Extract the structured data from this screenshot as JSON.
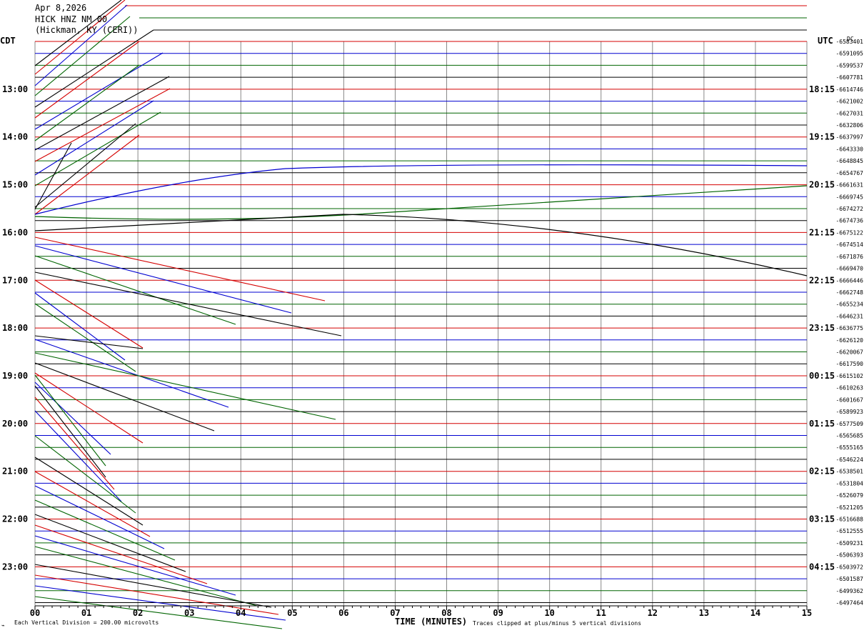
{
  "header": {
    "date": "Apr 8,2026",
    "station": "HICK HNZ NM 00",
    "location": "(Hickman, KY (CERI))"
  },
  "left_tz": "CDT",
  "right_tz": "UTC",
  "dc_header": "DC",
  "footer": {
    "scale": "Each Vertical Division =  200.00 microvolts",
    "clip_note": "Traces clipped at plus/minus 5 vertical divisions",
    "xlabel": "TIME (MINUTES)"
  },
  "colors": {
    "red": "#d40000",
    "blue": "#0000d0",
    "green": "#006400",
    "black": "#000000",
    "grid": "#888888"
  },
  "chart_data": {
    "type": "line",
    "xlabel": "TIME (MINUTES)",
    "xlim": [
      0,
      15
    ],
    "x_ticks": [
      "00",
      "01",
      "02",
      "03",
      "04",
      "05",
      "06",
      "07",
      "08",
      "09",
      "10",
      "11",
      "12",
      "13",
      "14",
      "15"
    ],
    "minutes_per_line": 15,
    "left_hour_labels": [
      "13:00",
      "14:00",
      "15:00",
      "16:00",
      "17:00",
      "18:00",
      "19:00",
      "20:00",
      "21:00",
      "22:00",
      "23:00"
    ],
    "right_hour_labels": [
      "18:15",
      "19:15",
      "20:15",
      "21:15",
      "22:15",
      "23:15",
      "00:15",
      "01:15",
      "02:15",
      "03:15",
      "04:15"
    ],
    "dc_values": [
      "-6583401",
      "-6591095",
      "-6599537",
      "-6607781",
      "-6614746",
      "-6621002",
      "-6627031",
      "-6632806",
      "-6637997",
      "-6643330",
      "-6648845",
      "-6654767",
      "-6661631",
      "-6669745",
      "-6674272",
      "-6674736",
      "-6675122",
      "-6674514",
      "-6671876",
      "-6669470",
      "-6666446",
      "-6662748",
      "-6655234",
      "-6646231",
      "-6636775",
      "-6626120",
      "-6620067",
      "-6617590",
      "-6615102",
      "-6610263",
      "-6601667",
      "-6589923",
      "-6577509",
      "-6565685",
      "-6555165",
      "-6546224",
      "-6538501",
      "-6531804",
      "-6526079",
      "-6521205",
      "-6516688",
      "-6512555",
      "-6509231",
      "-6506393",
      "-6503972",
      "-6501587",
      "-6499362",
      "-6497464"
    ],
    "scale_microvolts_per_division": 200.0
  }
}
